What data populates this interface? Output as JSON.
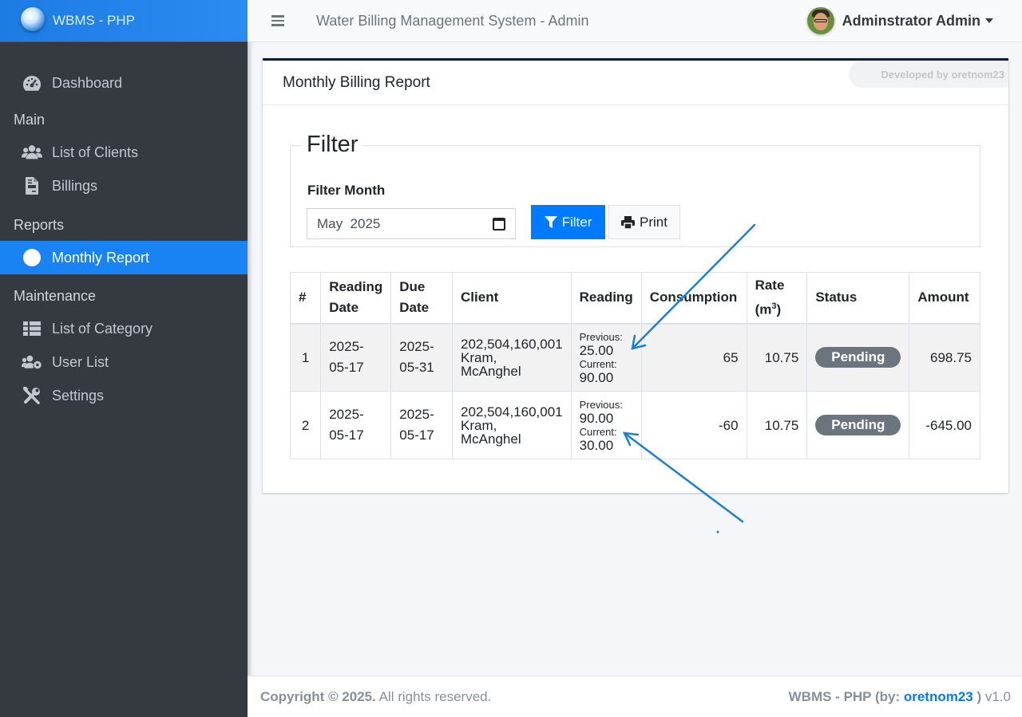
{
  "brand": {
    "name": "WBMS - PHP"
  },
  "sidebar": {
    "dashboard": "Dashboard",
    "main_header": "Main",
    "clients": "List of Clients",
    "billings": "Billings",
    "reports_header": "Reports",
    "monthly_report": "Monthly Report",
    "maintenance_header": "Maintenance",
    "category": "List of Category",
    "users": "User List",
    "settings": "Settings"
  },
  "topbar": {
    "title": "Water Billing Management System - Admin",
    "user_name": "Adminstrator Admin"
  },
  "card": {
    "title": "Monthly Billing Report",
    "developed_by": "Developed by oretnom23"
  },
  "filter": {
    "legend": "Filter",
    "label": "Filter Month",
    "month_value": "May  2025",
    "filter_button": "Filter",
    "print_button": "Print"
  },
  "table": {
    "headers": {
      "num": "#",
      "reading_date_1": "Reading",
      "reading_date_2": "Date",
      "due_date_1": "Due",
      "due_date_2": "Date",
      "client": "Client",
      "reading": "Reading",
      "consumption": "Consumption",
      "rate_1": "Rate",
      "rate_2": "(m",
      "rate_sup": "3",
      "rate_3": ")",
      "status": "Status",
      "amount": "Amount"
    },
    "rows": [
      {
        "num": "1",
        "reading_date_1": "2025-",
        "reading_date_2": "05-17",
        "due_date_1": "2025-",
        "due_date_2": "05-31",
        "client_code": "202,504,160,001",
        "client_name_1": "Kram,",
        "client_name_2": "McAnghel",
        "prev_label": "Previous:",
        "prev_value": "25.00",
        "curr_label": "Current:",
        "curr_value": "90.00",
        "consumption": "65",
        "rate": "10.75",
        "status": "Pending",
        "amount": "698.75"
      },
      {
        "num": "2",
        "reading_date_1": "2025-",
        "reading_date_2": "05-17",
        "due_date_1": "2025-",
        "due_date_2": "05-17",
        "client_code": "202,504,160,001",
        "client_name_1": "Kram,",
        "client_name_2": "McAnghel",
        "prev_label": "Previous:",
        "prev_value": "90.00",
        "curr_label": "Current:",
        "curr_value": "30.00",
        "consumption": "-60",
        "rate": "10.75",
        "status": "Pending",
        "amount": "-645.00"
      }
    ]
  },
  "footer": {
    "copyright_bold": "Copyright © 2025.",
    "copyright_rest": " All rights reserved.",
    "app_prefix": "WBMS - PHP (by: ",
    "author": "oretnom23",
    "app_suffix": " )",
    "version": " v1.0"
  },
  "colors": {
    "accent": "#007bff",
    "sidebar_bg": "#343a40",
    "badge_bg": "#6c757d",
    "annotation_arrow": "#1a7fd6"
  }
}
